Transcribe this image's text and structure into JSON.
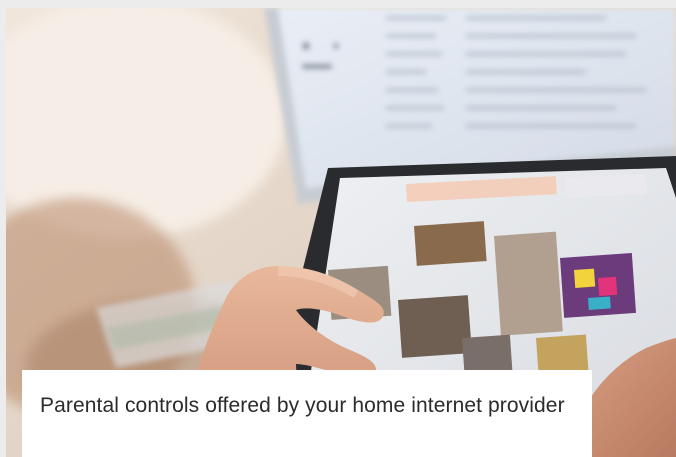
{
  "article": {
    "title": "Parental controls offered by your home internet provider"
  },
  "colors": {
    "page_background": "#ececec",
    "caption_background": "#ffffff",
    "title_text": "#2b2b2b"
  }
}
